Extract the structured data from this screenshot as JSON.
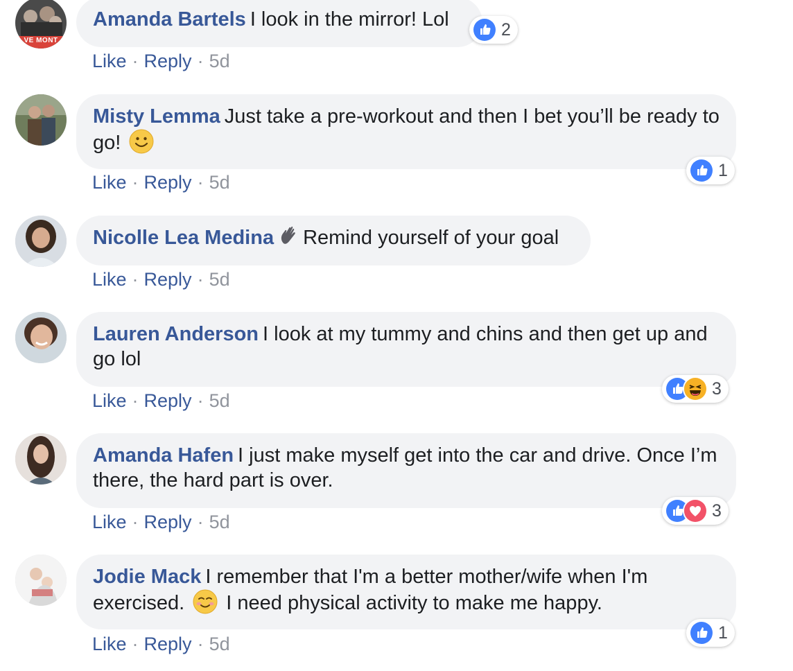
{
  "actions": {
    "like_label": "Like",
    "reply_label": "Reply",
    "separator": "·"
  },
  "colors": {
    "author_link": "#385898",
    "bubble_bg": "#f2f3f5",
    "meta_gray": "#90949c",
    "like_blue": "#4080ff",
    "love_red": "#f25268",
    "haha_yellow": "#f7b125"
  },
  "comments": [
    {
      "author": "Amanda Bartels",
      "text": "I look in the mirror! Lol",
      "time": "5d",
      "reactions": [
        "like-icon"
      ],
      "reaction_count": "2",
      "avatar_badge": "VE MONT"
    },
    {
      "author": "Misty Lemma",
      "text": "Just take a pre-workout and then I bet you’ll be ready to go!",
      "emoji": "smile-emoji",
      "time": "5d",
      "reactions": [
        "like-icon"
      ],
      "reaction_count": "1"
    },
    {
      "author": "Nicolle Lea Medina",
      "icon": "waving-hand-icon",
      "text": "Remind yourself of your goal",
      "time": "5d"
    },
    {
      "author": "Lauren Anderson",
      "text": "I look at my tummy and chins and then get up and go lol",
      "time": "5d",
      "reactions": [
        "like-icon",
        "haha-icon"
      ],
      "reaction_count": "3"
    },
    {
      "author": "Amanda Hafen",
      "text": "I just make myself get into the car and drive. Once I’m there, the hard part is over.",
      "time": "5d",
      "reactions": [
        "like-icon",
        "love-icon"
      ],
      "reaction_count": "3"
    },
    {
      "author": "Jodie Mack",
      "text_before": "I remember that I'm a better mother/wife when I'm exercised.",
      "emoji": "blush-emoji",
      "text_after": "I need physical activity to make me happy.",
      "time": "5d",
      "reactions": [
        "like-icon"
      ],
      "reaction_count": "1"
    }
  ]
}
